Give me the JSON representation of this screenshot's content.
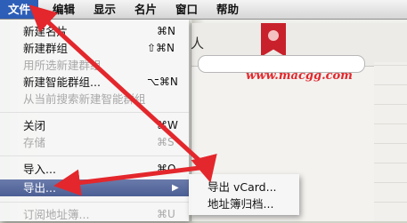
{
  "menubar": {
    "items": [
      "文件",
      "编辑",
      "显示",
      "名片",
      "窗口",
      "帮助"
    ]
  },
  "background_app": {
    "title_partial": "人",
    "watermark": "www.macgg.com"
  },
  "file_menu": {
    "items": [
      {
        "label": "新建名片",
        "shortcut": "⌘N",
        "enabled": true
      },
      {
        "label": "新建群组",
        "shortcut": "⇧⌘N",
        "enabled": true
      },
      {
        "label": "用所选新建群组",
        "shortcut": "",
        "enabled": false
      },
      {
        "label": "新建智能群组...",
        "shortcut": "⌥⌘N",
        "enabled": true
      },
      {
        "label": "从当前搜索新建智能群组",
        "shortcut": "",
        "enabled": false
      },
      {
        "label": "关闭",
        "shortcut": "⌘W",
        "enabled": true
      },
      {
        "label": "存储",
        "shortcut": "⌘S",
        "enabled": false
      },
      {
        "label": "导入...",
        "shortcut": "⌘O",
        "enabled": true
      },
      {
        "label": "导出...",
        "shortcut": "",
        "enabled": true,
        "submenu": "▶"
      },
      {
        "label": "订阅地址簿...",
        "shortcut": "⌘U",
        "enabled": false
      }
    ]
  },
  "export_submenu": {
    "items": [
      "导出 vCard...",
      "地址簿归档..."
    ]
  },
  "colors": {
    "highlight": "#4c5f94",
    "menubar_active": "#2d5eb8",
    "annotation_arrow": "#e3272c"
  }
}
